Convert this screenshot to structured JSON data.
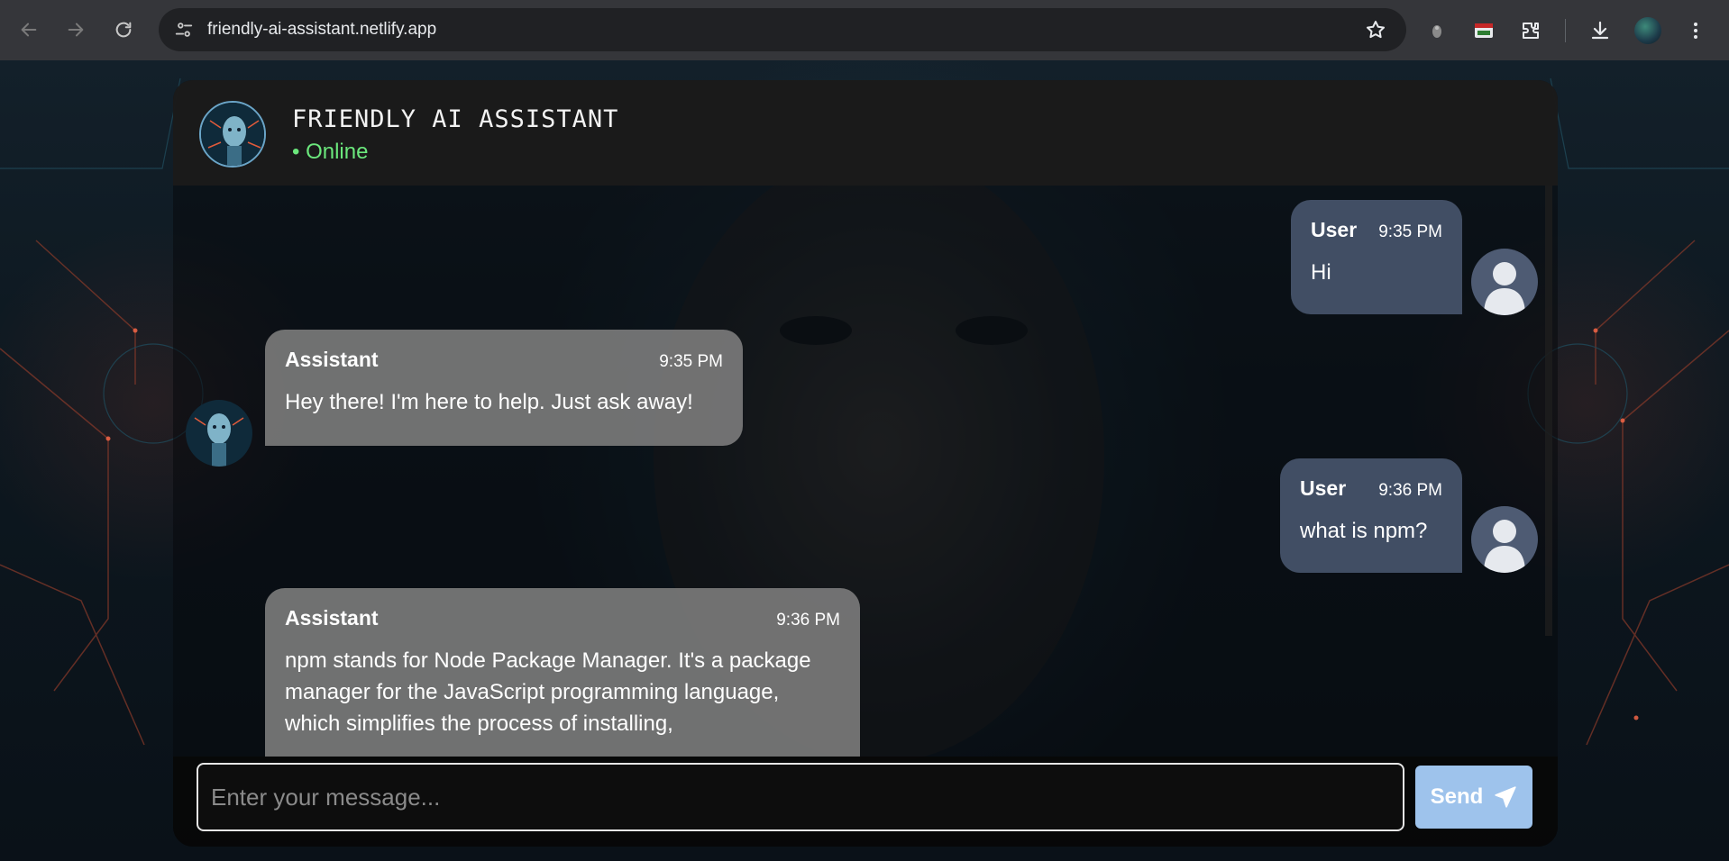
{
  "browser": {
    "url": "friendly-ai-assistant.netlify.app",
    "icons": [
      "back-icon",
      "forward-icon",
      "reload-icon",
      "site-settings-icon",
      "bookmark-star-icon",
      "extension-icon",
      "extensions-puzzle-icon",
      "download-icon",
      "profile-avatar",
      "menu-dots-icon"
    ]
  },
  "header": {
    "title": "FRIENDLY AI ASSISTANT",
    "status": "• Online"
  },
  "messages": [
    {
      "role": "user",
      "sender": "User",
      "time": "9:35 PM",
      "text": "Hi"
    },
    {
      "role": "assistant",
      "sender": "Assistant",
      "time": "9:35 PM",
      "text": "Hey there! I'm here to help. Just ask away!"
    },
    {
      "role": "user",
      "sender": "User",
      "time": "9:36 PM",
      "text": "what is npm?"
    },
    {
      "role": "assistant",
      "sender": "Assistant",
      "time": "9:36 PM",
      "text": "npm stands for Node Package Manager. It's a package manager for the JavaScript programming language, which simplifies the process of installing,"
    }
  ],
  "composer": {
    "placeholder": "Enter your message...",
    "send_label": "Send"
  },
  "colors": {
    "user_bubble": "#445268",
    "assistant_bubble": "#7a7a7a",
    "online": "#6be77c",
    "send_button": "#9ec3ec"
  }
}
